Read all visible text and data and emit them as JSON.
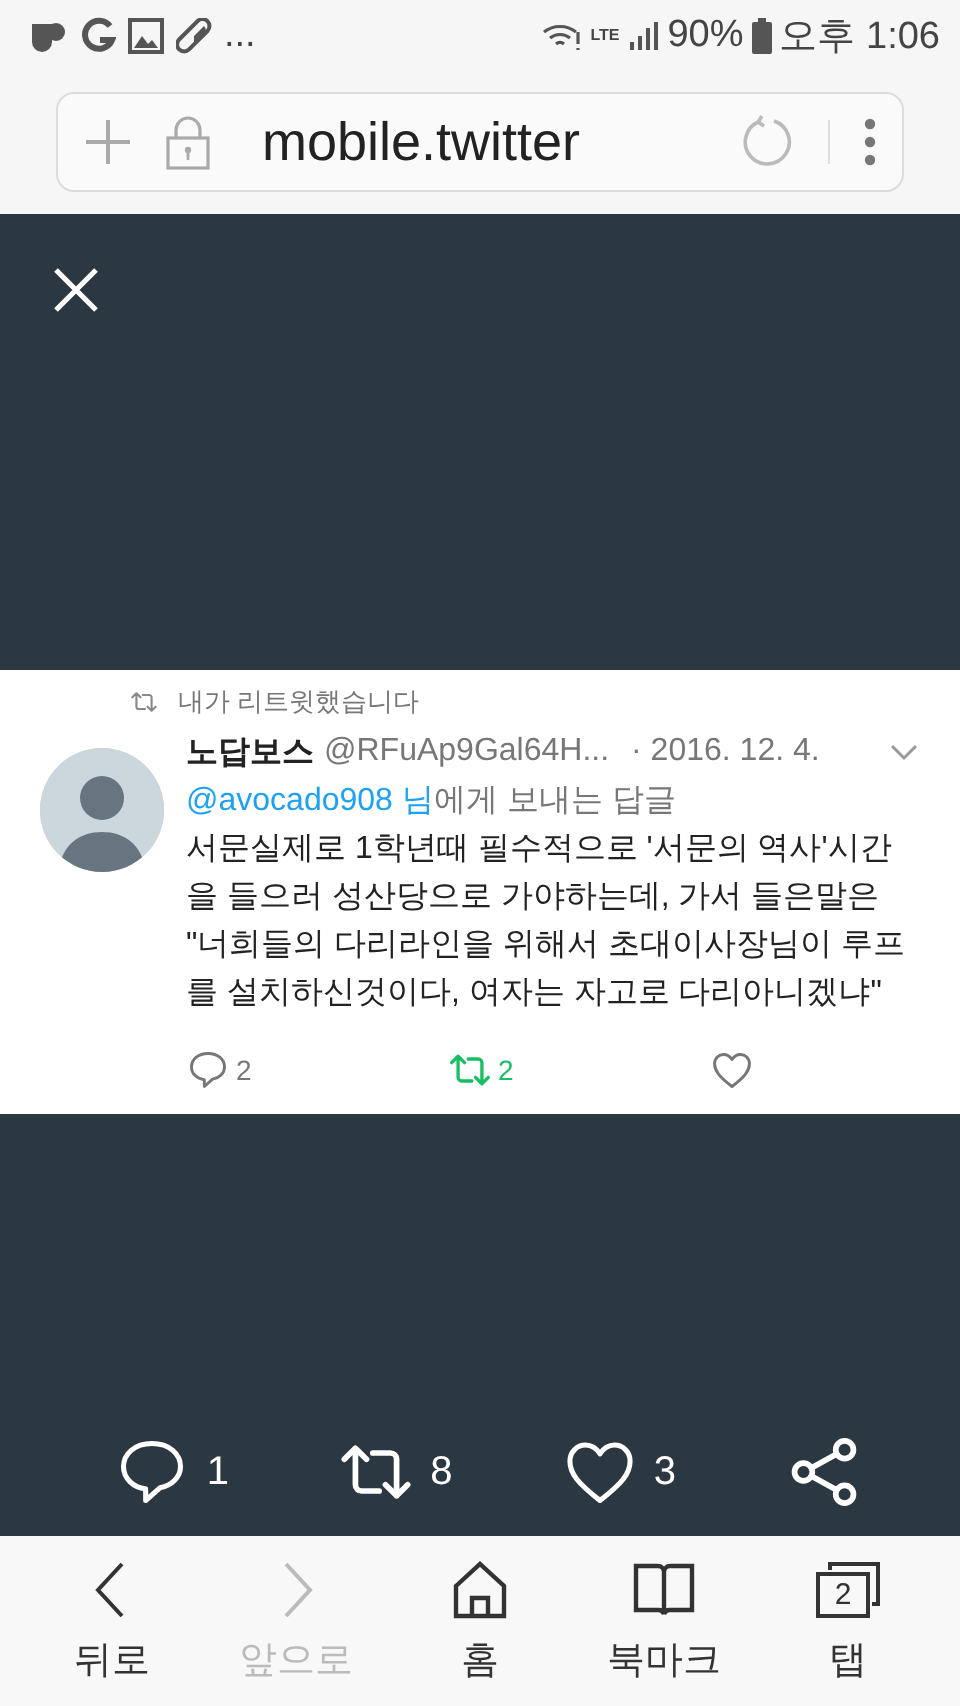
{
  "status_bar": {
    "more": "...",
    "network": "LTE",
    "battery": "90%",
    "time": "오후 1:06"
  },
  "address_bar": {
    "url": "mobile.twitter"
  },
  "tweet": {
    "retweet_note": "내가 리트윗했습니다",
    "author": "노답보스",
    "handle": "@RFuAp9Gal64H...",
    "date": "· 2016. 12. 4.",
    "reply_to": "@avocado908 님",
    "reply_suffix": "에게 보내는 답글",
    "text": "서문실제로 1학년때 필수적으로 '서문의 역사'시간을 들으러 성산당으로 가야하는데, 가서 들은말은 \"너희들의 다리라인을 위해서 초대이사장님이 루프를 설치하신것이다, 여자는 자고로 다리아니겠냐\"",
    "actions": [
      {
        "kind": "reply",
        "count": "2",
        "active": false
      },
      {
        "kind": "retweet",
        "count": "2",
        "active": true
      },
      {
        "kind": "like",
        "active": false
      }
    ]
  },
  "viewer_actions": [
    {
      "kind": "reply",
      "count": "1"
    },
    {
      "kind": "retweet",
      "count": "8"
    },
    {
      "kind": "like",
      "count": "3"
    },
    {
      "kind": "share"
    }
  ],
  "bottom_nav": [
    {
      "kind": "back",
      "label": "뒤로",
      "disabled": false
    },
    {
      "kind": "forward",
      "label": "앞으로",
      "disabled": true
    },
    {
      "kind": "home",
      "label": "홈",
      "disabled": false
    },
    {
      "kind": "bookmarks",
      "label": "북마크",
      "disabled": false
    },
    {
      "kind": "tabs",
      "label": "탭",
      "badge": "2",
      "disabled": false
    }
  ]
}
